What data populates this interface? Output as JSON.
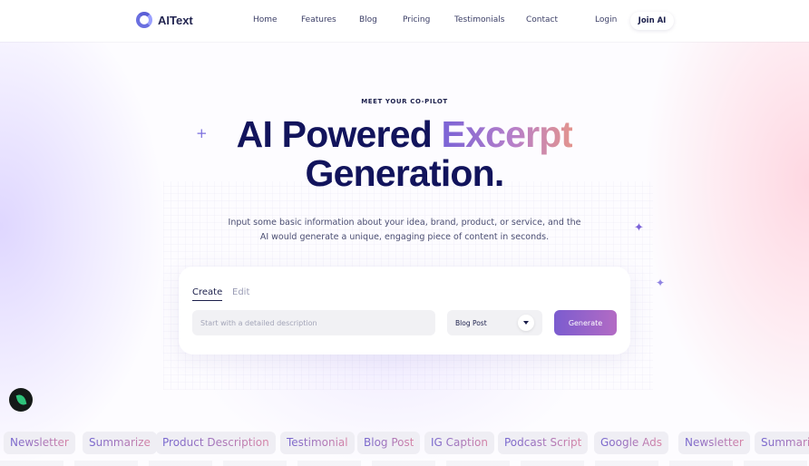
{
  "brand": {
    "name": "AIText"
  },
  "nav": {
    "links": [
      "Home",
      "Features",
      "Blog",
      "Pricing",
      "Testimonials",
      "Contact"
    ],
    "login": "Login",
    "join": "Join AI"
  },
  "hero": {
    "eyebrow": "MEET YOUR CO-PILOT",
    "title_part1": "AI Powered ",
    "title_accent": "Excerpt",
    "title_part2": "Generation.",
    "description": "Input some basic information about your idea, brand, product, or service, and the AI would generate a unique, engaging piece of content in seconds."
  },
  "generator": {
    "tabs": [
      "Create",
      "Edit"
    ],
    "active_tab": "Create",
    "description_placeholder": "Start with a detailed description",
    "description_value": "",
    "content_type": "Blog Post",
    "generate_label": "Generate"
  },
  "tags": [
    "Newsletter",
    "Summarize",
    "Product Description",
    "Testimonial",
    "Blog Post",
    "IG Caption",
    "Podcast Script",
    "Google Ads",
    "Newsletter",
    "Summarize"
  ],
  "colors": {
    "primary_text": "#12145c",
    "accent_gradient_start": "#7a63d6",
    "accent_gradient_end": "#e3948e",
    "generate_button": "#8f62cb",
    "chat_icon": "#2ec37a"
  }
}
